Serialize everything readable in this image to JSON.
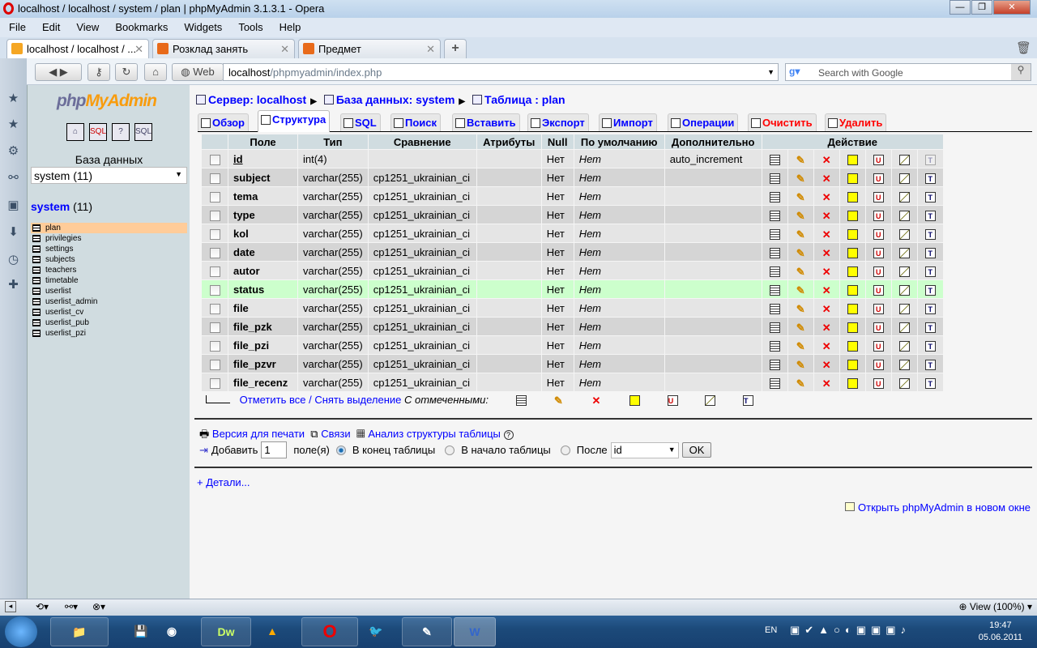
{
  "window": {
    "title": "localhost / localhost / system / plan | phpMyAdmin 3.1.3.1 - Opera"
  },
  "menu": [
    "File",
    "Edit",
    "View",
    "Bookmarks",
    "Widgets",
    "Tools",
    "Help"
  ],
  "browser_tabs": [
    {
      "label": "localhost / localhost / ...",
      "active": true
    },
    {
      "label": "Розклад занять",
      "active": false
    },
    {
      "label": "Предмет",
      "active": false
    }
  ],
  "address": {
    "web_label": "Web",
    "host": "localhost",
    "path": "/phpmyadmin/index.php",
    "search_placeholder": "Search with Google"
  },
  "nav": {
    "logo": {
      "php": "php",
      "my": "MyAdmin"
    },
    "db_label": "База данных",
    "db_select": "system (11)",
    "db_name": "system",
    "db_count": "(11)",
    "tables": [
      "plan",
      "privilegies",
      "settings",
      "subjects",
      "teachers",
      "timetable",
      "userlist",
      "userlist_admin",
      "userlist_cv",
      "userlist_pub",
      "userlist_pzi"
    ],
    "selected_table": "plan"
  },
  "breadcrumb": {
    "server": "Сервер: localhost",
    "database": "База данных: system",
    "table": "Таблица : plan"
  },
  "tabs": [
    "Обзор",
    "Структура",
    "SQL",
    "Поиск",
    "Вставить",
    "Экспорт",
    "Импорт",
    "Операции",
    "Очистить",
    "Удалить"
  ],
  "active_tab": "Структура",
  "columns": [
    "Поле",
    "Тип",
    "Сравнение",
    "Атрибуты",
    "Null",
    "По умолчанию",
    "Дополнительно",
    "Действие"
  ],
  "rows": [
    {
      "field": "id",
      "type": "int(4)",
      "collation": "",
      "attributes": "",
      "null": "Нет",
      "default": "Нет",
      "extra": "auto_increment"
    },
    {
      "field": "subject",
      "type": "varchar(255)",
      "collation": "cp1251_ukrainian_ci",
      "attributes": "",
      "null": "Нет",
      "default": "Нет",
      "extra": ""
    },
    {
      "field": "tema",
      "type": "varchar(255)",
      "collation": "cp1251_ukrainian_ci",
      "attributes": "",
      "null": "Нет",
      "default": "Нет",
      "extra": ""
    },
    {
      "field": "type",
      "type": "varchar(255)",
      "collation": "cp1251_ukrainian_ci",
      "attributes": "",
      "null": "Нет",
      "default": "Нет",
      "extra": ""
    },
    {
      "field": "kol",
      "type": "varchar(255)",
      "collation": "cp1251_ukrainian_ci",
      "attributes": "",
      "null": "Нет",
      "default": "Нет",
      "extra": ""
    },
    {
      "field": "date",
      "type": "varchar(255)",
      "collation": "cp1251_ukrainian_ci",
      "attributes": "",
      "null": "Нет",
      "default": "Нет",
      "extra": ""
    },
    {
      "field": "autor",
      "type": "varchar(255)",
      "collation": "cp1251_ukrainian_ci",
      "attributes": "",
      "null": "Нет",
      "default": "Нет",
      "extra": ""
    },
    {
      "field": "status",
      "type": "varchar(255)",
      "collation": "cp1251_ukrainian_ci",
      "attributes": "",
      "null": "Нет",
      "default": "Нет",
      "extra": ""
    },
    {
      "field": "file",
      "type": "varchar(255)",
      "collation": "cp1251_ukrainian_ci",
      "attributes": "",
      "null": "Нет",
      "default": "Нет",
      "extra": ""
    },
    {
      "field": "file_pzk",
      "type": "varchar(255)",
      "collation": "cp1251_ukrainian_ci",
      "attributes": "",
      "null": "Нет",
      "default": "Нет",
      "extra": ""
    },
    {
      "field": "file_pzi",
      "type": "varchar(255)",
      "collation": "cp1251_ukrainian_ci",
      "attributes": "",
      "null": "Нет",
      "default": "Нет",
      "extra": ""
    },
    {
      "field": "file_pzvr",
      "type": "varchar(255)",
      "collation": "cp1251_ukrainian_ci",
      "attributes": "",
      "null": "Нет",
      "default": "Нет",
      "extra": ""
    },
    {
      "field": "file_recenz",
      "type": "varchar(255)",
      "collation": "cp1251_ukrainian_ci",
      "attributes": "",
      "null": "Нет",
      "default": "Нет",
      "extra": ""
    }
  ],
  "highlighted_row": "status",
  "actions": [
    "browse-icon",
    "edit-icon",
    "drop-icon",
    "primary-icon",
    "unique-icon",
    "index-icon",
    "fulltext-icon"
  ],
  "bulk": {
    "check_all": "Отметить все",
    "sep": " / ",
    "uncheck_all": "Снять выделение",
    "with_selected": "С отмеченными:"
  },
  "links": {
    "print": "Версия для печати",
    "relations": "Связи",
    "analyze": "Анализ структуры таблицы"
  },
  "add": {
    "label": "Добавить",
    "count": "1",
    "fields": "поле(я)",
    "end": "В конец таблицы",
    "begin": "В начало таблицы",
    "after": "После",
    "after_value": "id",
    "ok": "OK"
  },
  "details": "+ Детали...",
  "open_new": "Открыть phpMyAdmin в новом окне",
  "statusbar": {
    "zoom": "View (100%)"
  },
  "taskbar": {
    "lang": "EN",
    "time": "19:47",
    "date": "05.06.2011"
  }
}
